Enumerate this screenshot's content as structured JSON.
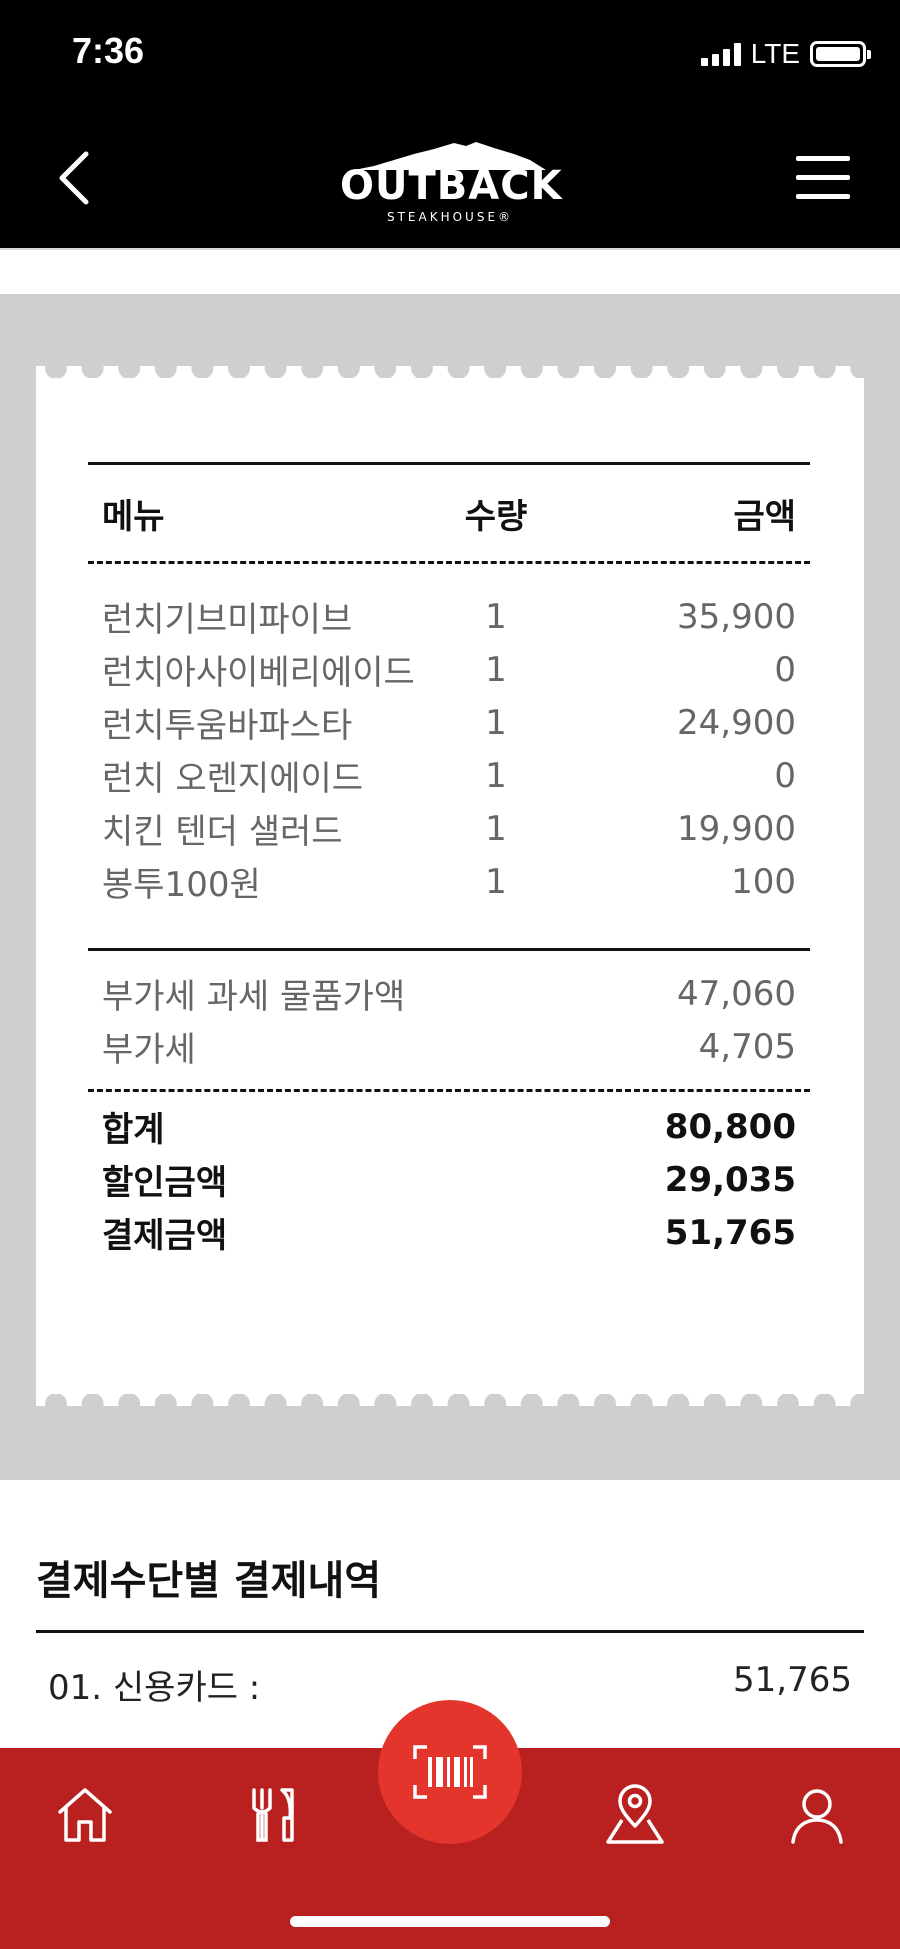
{
  "status_bar": {
    "time": "7:36",
    "network": "LTE"
  },
  "header": {
    "brand_main": "OUTBACK",
    "brand_sub": "STEAKHOUSE®",
    "back_icon": "chevron-left-icon",
    "menu_icon": "hamburger-menu-icon"
  },
  "receipt": {
    "columns": {
      "menu": "메뉴",
      "qty": "수량",
      "amount": "금액"
    },
    "items": [
      {
        "name": "런치기브미파이브",
        "qty": "1",
        "amount": "35,900"
      },
      {
        "name": "런치아사이베리에이드",
        "qty": "1",
        "amount": "0"
      },
      {
        "name": "런치투움바파스타",
        "qty": "1",
        "amount": "24,900"
      },
      {
        "name": "런치 오렌지에이드",
        "qty": "1",
        "amount": "0"
      },
      {
        "name": "치킨 텐더 샐러드",
        "qty": "1",
        "amount": "19,900"
      },
      {
        "name": "봉투100원",
        "qty": "1",
        "amount": "100"
      }
    ],
    "tax": [
      {
        "label": "부가세 과세 물품가액",
        "amount": "47,060"
      },
      {
        "label": "부가세",
        "amount": "4,705"
      }
    ],
    "totals": [
      {
        "label": "합계",
        "amount": "80,800"
      },
      {
        "label": "할인금액",
        "amount": "29,035"
      },
      {
        "label": "결제금액",
        "amount": "51,765"
      }
    ]
  },
  "payment": {
    "title": "결제수단별 결제내역",
    "rows": [
      {
        "label": "01. 신용카드 :",
        "amount": "51,765"
      }
    ]
  },
  "bottom_nav": {
    "accent_color": "#b8211f",
    "scan_color": "#e3352b",
    "items": [
      "home-icon",
      "menu-fork-knife-icon",
      "barcode-scan-icon",
      "location-pin-icon",
      "profile-icon"
    ]
  }
}
